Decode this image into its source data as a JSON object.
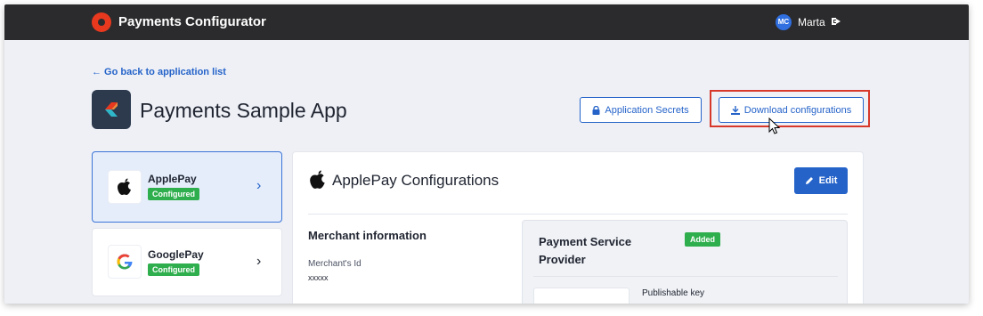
{
  "header": {
    "app_name": "Payments Configurator",
    "user_initials": "MC",
    "user_name": "Marta",
    "logout_icon": "logout-icon"
  },
  "nav": {
    "back_link": "← Go back to application list"
  },
  "page": {
    "title": "Payments Sample App"
  },
  "actions": {
    "secrets_label": "Application Secrets",
    "download_label": "Download configurations"
  },
  "sidebar": {
    "items": [
      {
        "name": "ApplePay",
        "status": "Configured",
        "icon": "apple-icon",
        "selected": true
      },
      {
        "name": "GooglePay",
        "status": "Configured",
        "icon": "google-icon",
        "selected": false
      }
    ]
  },
  "main": {
    "title": "ApplePay Configurations",
    "edit_label": "Edit",
    "merchant": {
      "heading": "Merchant information",
      "id_label": "Merchant's Id",
      "id_value": "xxxxx"
    },
    "psp": {
      "heading": "Payment Service Provider",
      "badge": "Added",
      "key_label": "Publishable key"
    }
  },
  "colors": {
    "accent": "#2563c9",
    "topbar": "#2b2b2d",
    "brand": "#e8391f",
    "success": "#2fae4d",
    "highlight": "#d8382a"
  }
}
